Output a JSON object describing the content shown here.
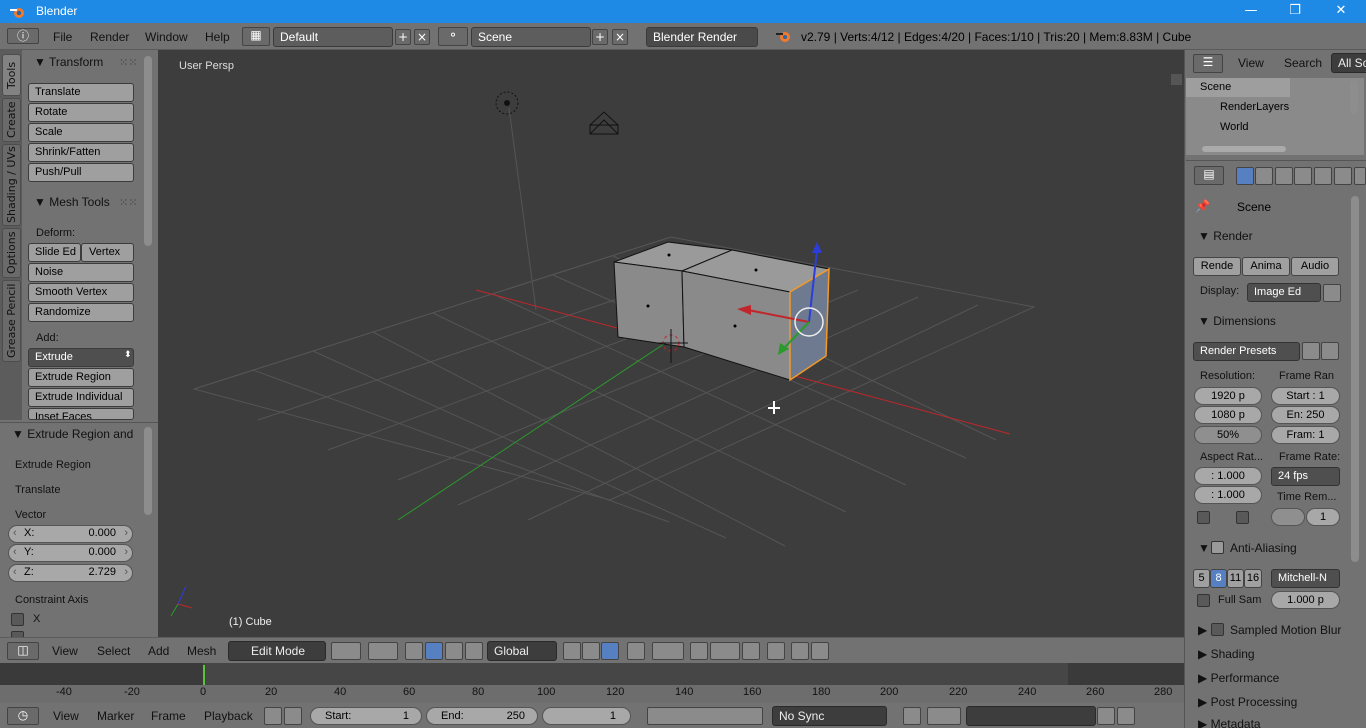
{
  "window": {
    "title": "Blender",
    "minimize": "—",
    "maximize": "❐",
    "close": "✕"
  },
  "menus": {
    "file": "File",
    "render": "Render",
    "window": "Window",
    "help": "Help"
  },
  "layout": {
    "value": "Default"
  },
  "scene": {
    "value": "Scene"
  },
  "engine": {
    "value": "Blender Render"
  },
  "stats": "v2.79 | Verts:4/12 | Edges:4/20 | Faces:1/10 | Tris:20 | Mem:8.83M | Cube",
  "toolshelf": {
    "tabs": [
      "Tools",
      "Create",
      "Shading / UVs",
      "Options",
      "Grease Pencil"
    ],
    "transform": {
      "title": "Transform",
      "buttons": [
        "Translate",
        "Rotate",
        "Scale",
        "Shrink/Fatten",
        "Push/Pull"
      ]
    },
    "mesh_tools": {
      "title": "Mesh Tools",
      "deform_label": "Deform:",
      "slide_edge": "Slide Ed",
      "vertex": "Vertex",
      "buttons": [
        "Noise",
        "Smooth Vertex",
        "Randomize"
      ],
      "add_label": "Add:",
      "extrude": "Extrude",
      "add_buttons": [
        "Extrude Region",
        "Extrude Individual",
        "Inset Faces"
      ]
    }
  },
  "redo": {
    "title": "Extrude Region and",
    "line1": "Extrude Region",
    "line2": "Translate",
    "vector_label": "Vector",
    "x_label": "X:",
    "x_value": "0.000",
    "y_label": "Y:",
    "y_value": "0.000",
    "z_label": "Z:",
    "z_value": "2.729",
    "constraint_label": "Constraint Axis",
    "constraint_x": "X"
  },
  "viewport": {
    "title": "User Persp",
    "object": "(1) Cube"
  },
  "v3d_header": {
    "view": "View",
    "select": "Select",
    "add": "Add",
    "mesh": "Mesh",
    "mode": "Edit Mode",
    "orientation": "Global"
  },
  "timeline": {
    "ticks": [
      "-40",
      "-20",
      "0",
      "20",
      "40",
      "60",
      "80",
      "100",
      "120",
      "140",
      "160",
      "180",
      "200",
      "220",
      "240",
      "260",
      "280"
    ]
  },
  "tl_header": {
    "view": "View",
    "marker": "Marker",
    "frame": "Frame",
    "playback": "Playback",
    "start_label": "Start:",
    "start_value": "1",
    "end_label": "End:",
    "end_value": "250",
    "current": "1",
    "sync": "No Sync"
  },
  "outliner": {
    "view": "View",
    "search": "Search",
    "filter": "All Sc",
    "items": [
      "Scene",
      "RenderLayers",
      "World"
    ]
  },
  "properties": {
    "context": "Scene",
    "render": {
      "title": "Render",
      "render_btn": "Rende",
      "anim_btn": "Anima",
      "audio_btn": "Audio",
      "display_label": "Display:",
      "display_value": "Image Ed"
    },
    "dimensions": {
      "title": "Dimensions",
      "presets": "Render Presets",
      "res_label": "Resolution:",
      "res_x": "1920 p",
      "res_y": "1080 p",
      "res_pct": "50%",
      "frame_range_label": "Frame Ran",
      "start": "Start : 1",
      "end": "En: 250",
      "step": "Fram: 1",
      "aspect_label": "Aspect Rat...",
      "aspect_x": ": 1.000",
      "aspect_y": ": 1.000",
      "frame_rate_label": "Frame Rate:",
      "frame_rate": "24 fps",
      "time_remap_label": "Time Rem...",
      "time_remap": "1"
    },
    "aa": {
      "title": "Anti-Aliasing",
      "samples": [
        "5",
        "8",
        "11",
        "16"
      ],
      "filter": "Mitchell-N",
      "full_sample": "Full Sam",
      "filter_size": "1.000 p"
    },
    "collapsed": [
      "Sampled Motion Blur",
      "Shading",
      "Performance",
      "Post Processing",
      "Metadata"
    ]
  },
  "colors": {
    "title_blue": "#1f8ae6",
    "panel_gray": "#727272",
    "viewport_bg": "#3d3d3d",
    "x_axis": "#c0262b",
    "y_axis": "#2a9b2a",
    "selection": "#f39a2a",
    "sample_active": "#5680c2"
  }
}
